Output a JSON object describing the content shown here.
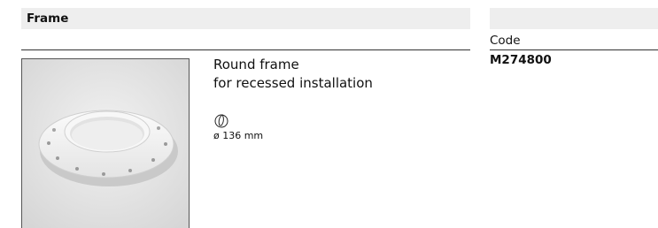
{
  "section": {
    "title": "Frame"
  },
  "code_column": {
    "header": "Code",
    "value": "M274800"
  },
  "product": {
    "name_line1": "Round frame",
    "name_line2": "for recessed installation",
    "dimension": "ø 136 mm",
    "image_icon": "round-frame-photo",
    "dimension_icon": "hand-drawn-circle-icon"
  }
}
